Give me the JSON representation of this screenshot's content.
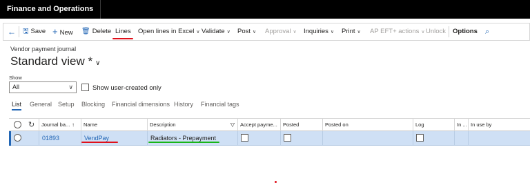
{
  "app": {
    "title": "Finance and Operations"
  },
  "toolbar": {
    "back_icon": "back-arrow-icon",
    "save": "Save",
    "new": "New",
    "delete": "Delete",
    "lines": "Lines",
    "open_lines_excel": "Open lines in Excel",
    "validate": "Validate",
    "post": "Post",
    "approval": "Approval",
    "inquiries": "Inquiries",
    "print": "Print",
    "ap_eft": "AP EFT+ actions",
    "unlock": "Unlock",
    "options": "Options",
    "search_icon": "search-icon"
  },
  "page": {
    "caption": "Vendor payment journal",
    "view_title": "Standard view *"
  },
  "filter": {
    "show_label": "Show",
    "show_value": "All",
    "show_user_created": "Show user-created only"
  },
  "tabs": [
    "List",
    "General",
    "Setup",
    "Blocking",
    "Financial dimensions",
    "History",
    "Financial tags"
  ],
  "grid": {
    "headers": [
      "Journal ba...",
      "Name",
      "Description",
      "Accept payme...",
      "Posted",
      "Posted on",
      "Log",
      "In ...",
      "In use by"
    ],
    "rows": [
      {
        "journal_batch": "01893",
        "name": "VendPay",
        "description": "Radiators - Prepayment"
      }
    ]
  },
  "colors": {
    "topbar": "#000000",
    "accent": "#2266b5",
    "selected_row": "#cfe0f5",
    "annotation_red": "#e0101a",
    "annotation_green": "#18b518"
  }
}
